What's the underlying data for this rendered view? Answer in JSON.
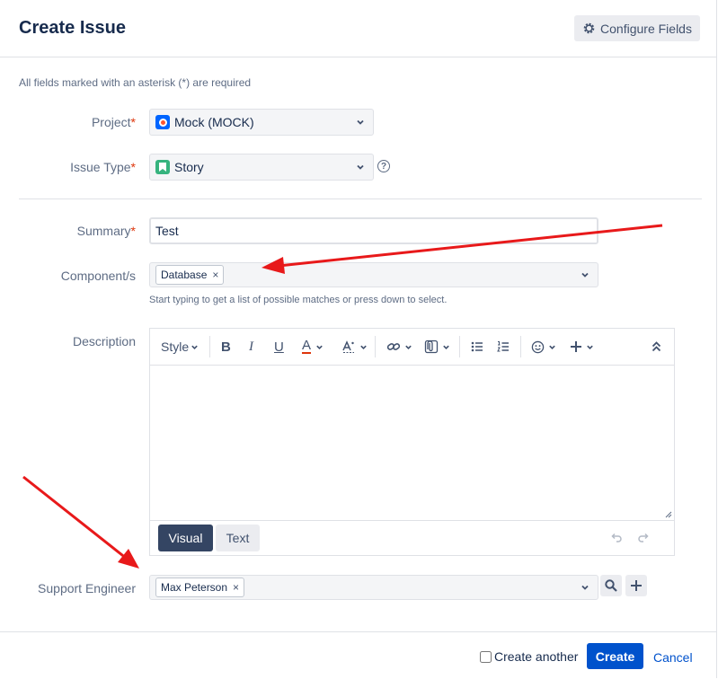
{
  "dialog": {
    "title": "Create Issue",
    "configure_label": "Configure Fields"
  },
  "required_note": "All fields marked with an asterisk (*) are required",
  "fields": {
    "project": {
      "label": "Project",
      "value": "Mock (MOCK)"
    },
    "issue_type": {
      "label": "Issue Type",
      "value": "Story"
    },
    "summary": {
      "label": "Summary",
      "value": "Test"
    },
    "components": {
      "label": "Component/s",
      "chip": "Database",
      "hint": "Start typing to get a list of possible matches or press down to select."
    },
    "description": {
      "label": "Description"
    },
    "support_engineer": {
      "label": "Support Engineer",
      "chip": "Max Peterson"
    }
  },
  "required_star": "*",
  "chip_remove": "×",
  "help_glyph": "?",
  "editor": {
    "style_label": "Style",
    "bold": "B",
    "italic": "I",
    "underline": "U",
    "text_color": "A",
    "visual_label": "Visual",
    "text_label": "Text"
  },
  "footer": {
    "create_another_label": "Create another",
    "create_label": "Create",
    "cancel_label": "Cancel"
  },
  "colors": {
    "primary": "#0052cc",
    "required": "#de350b",
    "annotation_arrow": "#e8191a",
    "visual_tab": "#344563"
  }
}
